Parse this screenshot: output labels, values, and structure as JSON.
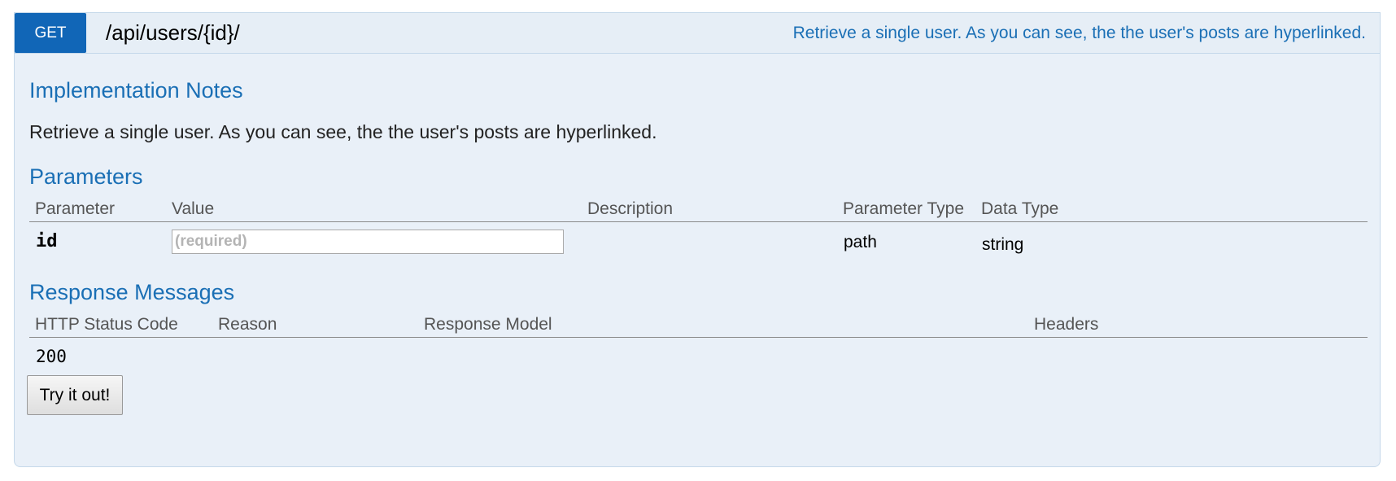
{
  "operation": {
    "method": "GET",
    "path": "/api/users/{id}/",
    "summary": "Retrieve a single user. As you can see, the the user's posts are hyperlinked."
  },
  "implementation_notes": {
    "title": "Implementation Notes",
    "text": "Retrieve a single user. As you can see, the the user's posts are hyperlinked."
  },
  "parameters": {
    "title": "Parameters",
    "columns": {
      "parameter": "Parameter",
      "value": "Value",
      "description": "Description",
      "parameter_type": "Parameter Type",
      "data_type": "Data Type"
    },
    "rows": [
      {
        "name": "id",
        "value": "",
        "placeholder": "(required)",
        "description": "",
        "parameter_type": "path",
        "data_type": "string"
      }
    ]
  },
  "response_messages": {
    "title": "Response Messages",
    "columns": {
      "status_code": "HTTP Status Code",
      "reason": "Reason",
      "response_model": "Response Model",
      "headers": "Headers"
    },
    "rows": [
      {
        "status_code": "200",
        "reason": "",
        "response_model": "",
        "headers": ""
      }
    ]
  },
  "try_button": {
    "label": "Try it out!"
  },
  "colors": {
    "method_get": "#1166b7",
    "accent_text": "#1a6fb5",
    "panel_background": "#e9f0f8"
  }
}
